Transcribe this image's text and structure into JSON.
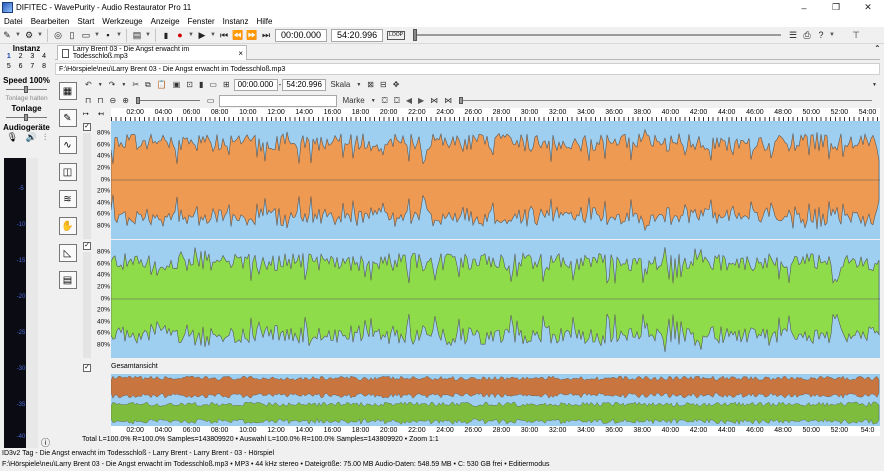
{
  "window": {
    "title": "DIFITEC - WavePurity - Audio Restaurator Pro 11",
    "minimize": "–",
    "restore": "❐",
    "close": "✕"
  },
  "menu": [
    "Datei",
    "Bearbeiten",
    "Start",
    "Werkzeuge",
    "Anzeige",
    "Fenster",
    "Instanz",
    "Hilfe"
  ],
  "toolbar": {
    "time_start": "00:00.000",
    "time_end": "54:20.996",
    "loop_label": "LOOP",
    "seek_fraction": 0.0
  },
  "left_panel": {
    "instanz_label": "Instanz",
    "instances": [
      "1",
      "2",
      "3",
      "4",
      "5",
      "6",
      "7",
      "8"
    ],
    "speed_label": "Speed 100%",
    "tonlage_halten_label": "Tonlage halten",
    "tonlage_label": "Tonlage",
    "audiogeraete_label": "Audiogeräte",
    "meter_labels": [
      "-5",
      "-10",
      "-15",
      "-20",
      "-25",
      "-30",
      "-35",
      "-40"
    ]
  },
  "document": {
    "tab_label": "Larry Brent 03 - Die Angst erwacht im Todesschloß.mp3",
    "tab_close": "×",
    "path": "F:\\Hörspiele\\neu\\Larry Brent 03 - Die Angst erwacht im Todesschloß.mp3"
  },
  "edit": {
    "sel_start": "00:00.000",
    "sel_end": "54:20.996",
    "skala_label": "Skala",
    "marke_label": "Marke"
  },
  "ruler": {
    "labels": [
      "02:00",
      "04:00",
      "06:00",
      "08:00",
      "10:00",
      "12:00",
      "14:00",
      "16:00",
      "18:00",
      "20:00",
      "22:00",
      "24:00",
      "26:00",
      "28:00",
      "30:00",
      "32:00",
      "34:00",
      "36:00",
      "38:00",
      "40:00",
      "42:00",
      "44:00",
      "46:00",
      "48:00",
      "50:00",
      "52:00",
      "54:00"
    ]
  },
  "channels": {
    "axis_labels": [
      "80%",
      "60%",
      "40%",
      "20%",
      "0%",
      "20%",
      "40%",
      "60%",
      "80%"
    ],
    "left_color": "#ee9a52",
    "right_color": "#8fdc4a",
    "background_color": "#9ecff0"
  },
  "overview": {
    "label": "Gesamtansicht",
    "ruler_labels": [
      "02:00",
      "04:00",
      "06:00",
      "08:00",
      "10:00",
      "12:00",
      "14:00",
      "16:00",
      "18:00",
      "20:00",
      "22:00",
      "24:00",
      "26:00",
      "28:00",
      "30:00",
      "32:00",
      "34:00",
      "36:00",
      "38:00",
      "40:00",
      "42:00",
      "44:00",
      "46:00",
      "48:00",
      "50:00",
      "52:00",
      "54:0"
    ],
    "left_color": "#c9753f",
    "right_color": "#7dbc3d"
  },
  "status": {
    "line1": "Total L=100.0% R=100.0% Samples=143809920 • Auswahl L=100.0% R=100.0% Samples=143809920 • Zoom 1:1",
    "line2": "ID3v2 Tag - Die Angst erwacht im Todesschloß - Larry Brent - Larry Brent - 03 - Hörspiel",
    "line3": "F:\\Hörspiele\\neu\\Larry Brent 03 - Die Angst erwacht im Todesschloß.mp3 • MP3 • 44 kHz stereo • Dateigröße: 75.00 MB  Audio-Daten: 548.59 MB • C: 530 GB frei • Editiermodus"
  }
}
